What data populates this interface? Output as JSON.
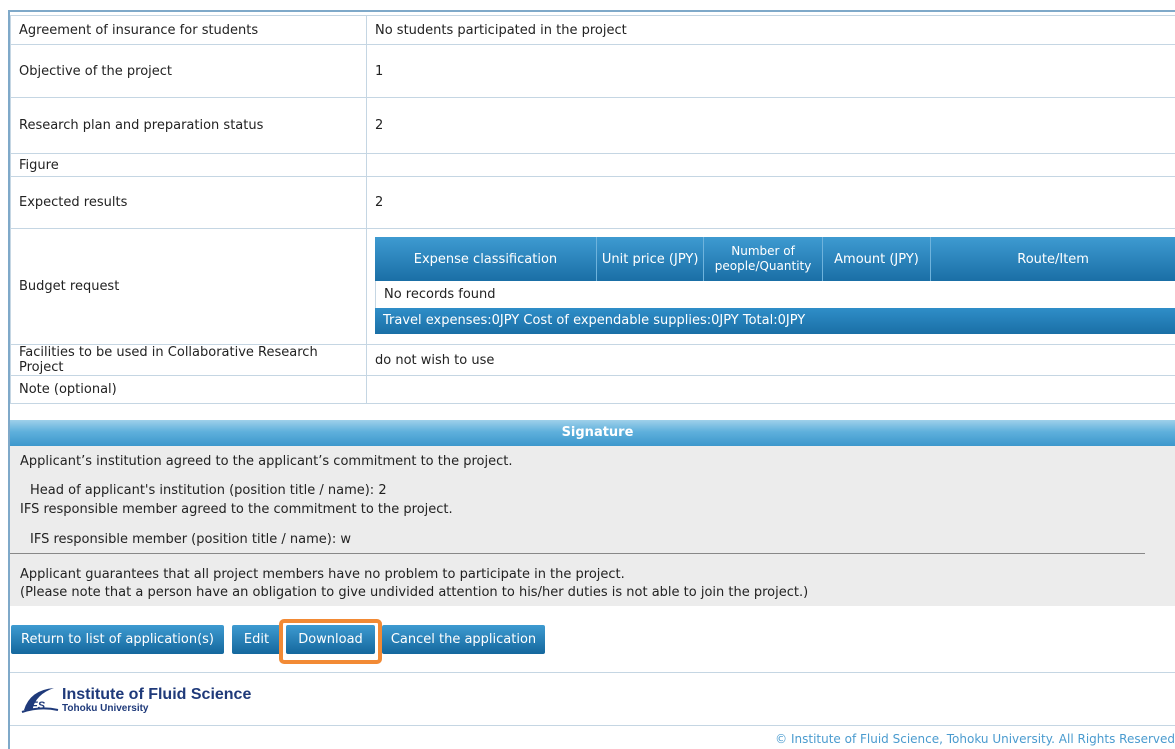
{
  "rows": {
    "insurance": {
      "label": "Agreement of insurance for students",
      "value": "No students participated in the project"
    },
    "objective": {
      "label": "Objective of the project",
      "value": "1"
    },
    "plan": {
      "label": "Research plan and preparation status",
      "value": "2"
    },
    "figure": {
      "label": "Figure",
      "value": ""
    },
    "results": {
      "label": "Expected results",
      "value": "2"
    },
    "budget": {
      "label": "Budget request"
    },
    "facilities": {
      "label": "Facilities to be used in Collaborative Research Project",
      "value": "do not wish to use"
    },
    "note": {
      "label": "Note (optional)",
      "value": ""
    }
  },
  "budget_table": {
    "columns": [
      "Expense classification",
      "Unit price (JPY)",
      "Number of people/Quantity",
      "Amount (JPY)",
      "Route/Item"
    ],
    "empty_text": "No records found",
    "totals": "Travel expenses:0JPY   Cost of expendable supplies:0JPY   Total:0JPY"
  },
  "signature": {
    "header": "Signature",
    "line1": "Applicant’s institution agreed to the applicant’s commitment to the project.",
    "line2": "Head of applicant's institution (position title / name): 2",
    "line3": "IFS responsible member agreed to the commitment to the project.",
    "line4": "IFS responsible member (position title / name): w",
    "line5": "Applicant guarantees that all project members have no problem to participate in the project.",
    "line6": "(Please note that a person have an obligation to give undivided attention to his/her duties is not able to join the project.)"
  },
  "buttons": {
    "return": "Return to list of application(s)",
    "edit": "Edit",
    "download": "Download",
    "cancel": "Cancel the application"
  },
  "footer": {
    "logo_mark": "IFS",
    "org_name": "Institute of Fluid Science",
    "university": "Tohoku University",
    "copyright": "© Institute of Fluid Science, Tohoku University. All Rights Reserved"
  },
  "colors": {
    "accent": "#1a6fa6",
    "highlight": "#f28a35",
    "signature_bg": "#ececec"
  }
}
